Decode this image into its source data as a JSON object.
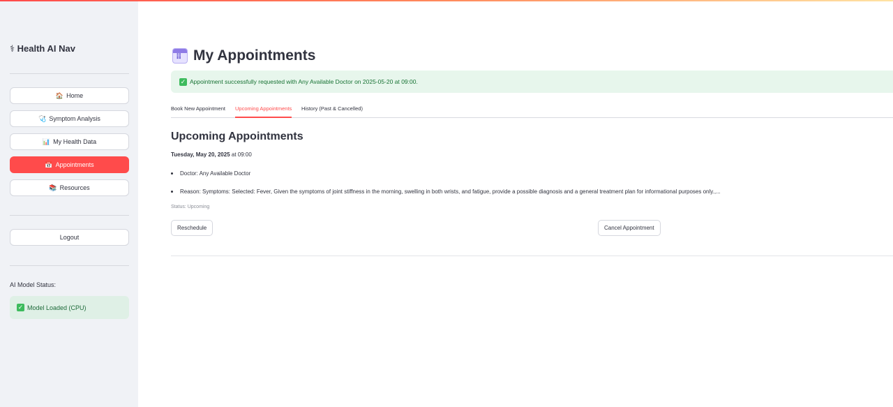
{
  "sidebar": {
    "brand": "⚕ Health AI Nav",
    "nav": [
      {
        "icon": "🏠",
        "label": "Home"
      },
      {
        "icon": "🩺",
        "label": "Symptom Analysis"
      },
      {
        "icon": "📊",
        "label": "My Health Data"
      },
      {
        "icon": "📅",
        "label": "Appointments"
      },
      {
        "icon": "📚",
        "label": "Resources"
      }
    ],
    "logout_label": "Logout",
    "model_status_label": "AI Model Status:",
    "model_status_value": "Model Loaded (CPU)"
  },
  "main": {
    "title": "My Appointments",
    "alert": "Appointment successfully requested with Any Available Doctor on 2025-05-20 at 09:00.",
    "tabs": [
      {
        "label": "Book New Appointment"
      },
      {
        "label": "Upcoming Appointments"
      },
      {
        "label": "History (Past & Cancelled)"
      }
    ],
    "active_tab": "Upcoming Appointments",
    "section_title": "Upcoming Appointments",
    "appointment": {
      "date": "Tuesday, May 20, 2025",
      "time_text": "at 09:00",
      "doctor": "Doctor: Any Available Doctor",
      "reason": "Reason: Symptoms: Selected: Fever, Given the symptoms of joint stiffness in the morning, swelling in both wrists, and fatigue, provide a possible diagnosis and a general treatment plan for informational purposes only.,...",
      "status": "Status: Upcoming",
      "reschedule_label": "Reschedule",
      "cancel_label": "Cancel Appointment"
    }
  },
  "colors": {
    "accent": "#ff4b4b",
    "sidebar_bg": "#f0f2f6",
    "success_bg": "#e7f6ec",
    "success_text": "#177233"
  }
}
